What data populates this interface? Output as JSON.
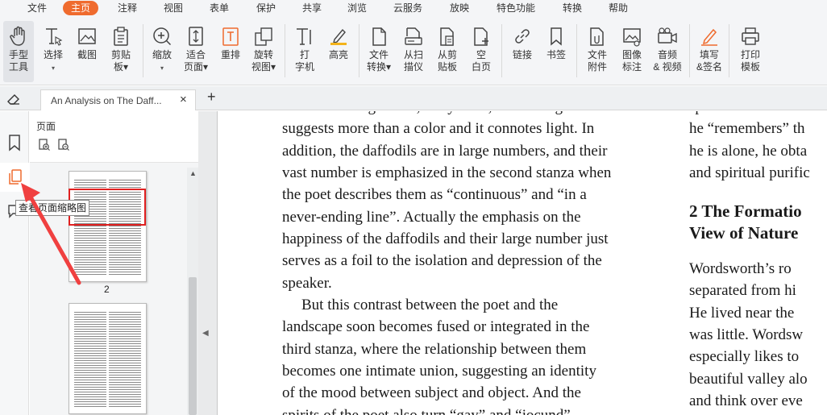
{
  "menu": {
    "items": [
      "文件",
      "主页",
      "注释",
      "视图",
      "表单",
      "保护",
      "共享",
      "浏览",
      "云服务",
      "放映",
      "特色功能",
      "转换",
      "帮助"
    ],
    "active": "主页"
  },
  "ribbon": {
    "tools": [
      {
        "label1": "手型",
        "label2": "工具",
        "icon": "hand-icon"
      },
      {
        "label1": "选择",
        "label2": "▾",
        "icon": "text-select-icon"
      },
      {
        "label1": "截图",
        "label2": "",
        "icon": "screenshot-icon"
      },
      {
        "label1": "剪贴",
        "label2": "板▾",
        "icon": "clipboard-icon"
      },
      {
        "label1": "缩放",
        "label2": "▾",
        "icon": "zoom-icon"
      },
      {
        "label1": "适合",
        "label2": "页面▾",
        "icon": "fit-page-icon"
      },
      {
        "label1": "重排",
        "label2": "",
        "icon": "reflow-icon"
      },
      {
        "label1": "旋转",
        "label2": "视图▾",
        "icon": "rotate-icon"
      },
      {
        "label1": "打",
        "label2": "字机",
        "icon": "typewriter-icon"
      },
      {
        "label1": "高亮",
        "label2": "",
        "icon": "highlight-icon"
      },
      {
        "label1": "文件",
        "label2": "转换▾",
        "icon": "file-convert-icon"
      },
      {
        "label1": "从扫",
        "label2": "描仪",
        "icon": "scanner-icon"
      },
      {
        "label1": "从剪",
        "label2": "贴板",
        "icon": "from-clipboard-icon"
      },
      {
        "label1": "空",
        "label2": "白页",
        "icon": "blank-page-icon"
      },
      {
        "label1": "链接",
        "label2": "",
        "icon": "link-icon"
      },
      {
        "label1": "书签",
        "label2": "",
        "icon": "bookmark-icon"
      },
      {
        "label1": "文件",
        "label2": "附件",
        "icon": "attachment-icon"
      },
      {
        "label1": "图像",
        "label2": "标注",
        "icon": "image-annotation-icon"
      },
      {
        "label1": "音频",
        "label2": "& 视频",
        "icon": "video-icon"
      },
      {
        "label1": "填写",
        "label2": "&签名",
        "icon": "sign-icon"
      },
      {
        "label1": "打印",
        "label2": "模板",
        "icon": "print-icon"
      }
    ]
  },
  "tabs": {
    "doc_title": "An Analysis on The Daff...",
    "close": "×",
    "new": "+"
  },
  "thumbnails": {
    "title": "页面",
    "page_number": "2",
    "tooltip": "查看页面缩略图"
  },
  "document": {
    "col1": [
      "described as “golden”, not yellow, because “golden”",
      "suggests more than a color and it connotes light. In",
      "addition, the daffodils are in large numbers, and their",
      "vast number is emphasized in the second stanza when",
      "the poet describes them as “continuous” and “in a",
      "never-ending line”. Actually the emphasis on the",
      "happiness of the daffodils and their large number just",
      "serves as a foil to the isolation and depression of the",
      "speaker.",
      "But this contrast between the poet and the",
      "landscape soon becomes fused or integrated in the",
      "third stanza, where the relationship between them",
      "becomes one intimate union, suggesting an identity",
      "of the mood between subject and object. And the",
      "spirits of the poet also turn “gay” and “jocund”"
    ],
    "col2_top": [
      "spirit is transform",
      "he “remembers” th",
      "he is alone, he obta",
      "and spiritual purific"
    ],
    "col2_heading": [
      "2  The Formatio",
      "View of Nature"
    ],
    "col2_body": [
      "Wordsworth’s ro",
      "separated from hi",
      "He lived near the",
      "was little. Wordsw",
      "especially likes to",
      "beautiful valley alo",
      "and think over eve"
    ]
  },
  "colors": {
    "accent": "#ef6b2e",
    "highlight_box": "#e02020",
    "arrow": "#f04040"
  }
}
